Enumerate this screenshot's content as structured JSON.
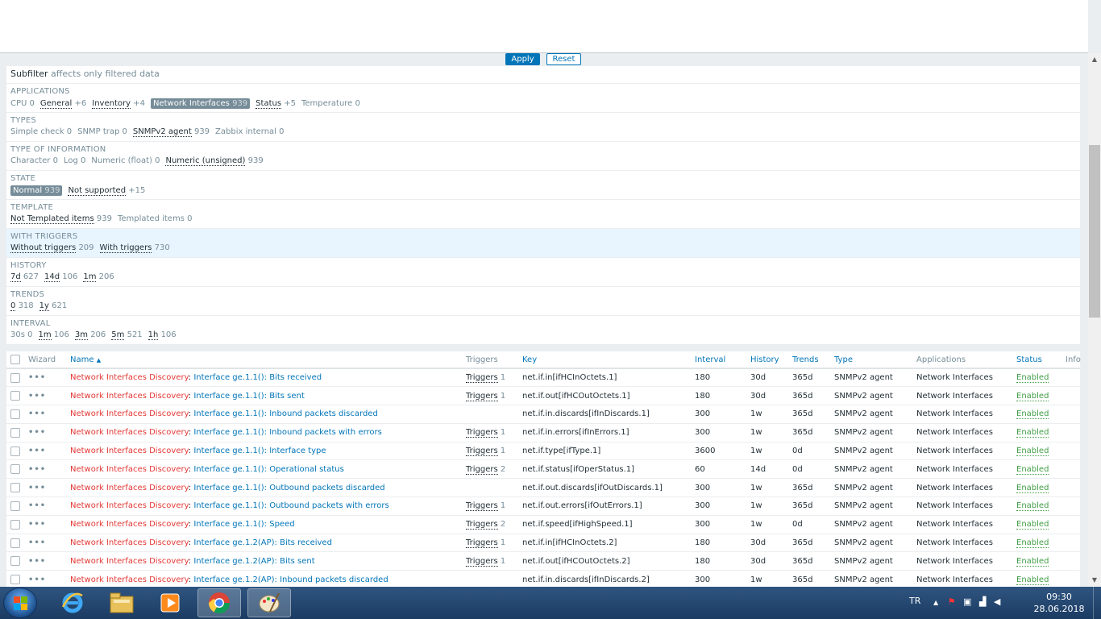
{
  "filter": {
    "apply_label": "Apply",
    "reset_label": "Reset"
  },
  "subfilter": {
    "title": "Subfilter",
    "note": "affects only filtered data",
    "groups": [
      {
        "heading": "APPLICATIONS",
        "items": [
          {
            "label": "CPU",
            "count": "0",
            "link": false,
            "selected": false
          },
          {
            "label": "General",
            "count": "+6",
            "link": true,
            "selected": false
          },
          {
            "label": "Inventory",
            "count": "+4",
            "link": true,
            "selected": false
          },
          {
            "label": "Network Interfaces",
            "count": "939",
            "link": true,
            "selected": true
          },
          {
            "label": "Status",
            "count": "+5",
            "link": true,
            "selected": false
          },
          {
            "label": "Temperature",
            "count": "0",
            "link": false,
            "selected": false
          }
        ]
      },
      {
        "heading": "TYPES",
        "items": [
          {
            "label": "Simple check",
            "count": "0",
            "link": false,
            "selected": false
          },
          {
            "label": "SNMP trap",
            "count": "0",
            "link": false,
            "selected": false
          },
          {
            "label": "SNMPv2 agent",
            "count": "939",
            "link": true,
            "selected": false
          },
          {
            "label": "Zabbix internal",
            "count": "0",
            "link": false,
            "selected": false
          }
        ]
      },
      {
        "heading": "TYPE OF INFORMATION",
        "items": [
          {
            "label": "Character",
            "count": "0",
            "link": false,
            "selected": false
          },
          {
            "label": "Log",
            "count": "0",
            "link": false,
            "selected": false
          },
          {
            "label": "Numeric (float)",
            "count": "0",
            "link": false,
            "selected": false
          },
          {
            "label": "Numeric (unsigned)",
            "count": "939",
            "link": true,
            "selected": false
          }
        ]
      },
      {
        "heading": "STATE",
        "items": [
          {
            "label": "Normal",
            "count": "939",
            "link": true,
            "selected": true
          },
          {
            "label": "Not supported",
            "count": "+15",
            "link": true,
            "selected": false
          }
        ]
      },
      {
        "heading": "TEMPLATE",
        "items": [
          {
            "label": "Not Templated items",
            "count": "939",
            "link": true,
            "selected": false
          },
          {
            "label": "Templated items",
            "count": "0",
            "link": false,
            "selected": false
          }
        ]
      },
      {
        "heading": "WITH TRIGGERS",
        "highlight": true,
        "items": [
          {
            "label": "Without triggers",
            "count": "209",
            "link": true,
            "selected": false
          },
          {
            "label": "With triggers",
            "count": "730",
            "link": true,
            "selected": false
          }
        ]
      },
      {
        "heading": "HISTORY",
        "items": [
          {
            "label": "7d",
            "count": "627",
            "link": true,
            "selected": false
          },
          {
            "label": "14d",
            "count": "106",
            "link": true,
            "selected": false
          },
          {
            "label": "1m",
            "count": "206",
            "link": true,
            "selected": false
          }
        ]
      },
      {
        "heading": "TRENDS",
        "items": [
          {
            "label": "0",
            "count": "318",
            "link": true,
            "selected": false
          },
          {
            "label": "1y",
            "count": "621",
            "link": true,
            "selected": false
          }
        ]
      },
      {
        "heading": "INTERVAL",
        "items": [
          {
            "label": "30s",
            "count": "0",
            "link": false,
            "selected": false
          },
          {
            "label": "1m",
            "count": "106",
            "link": true,
            "selected": false
          },
          {
            "label": "3m",
            "count": "206",
            "link": true,
            "selected": false
          },
          {
            "label": "5m",
            "count": "521",
            "link": true,
            "selected": false
          },
          {
            "label": "1h",
            "count": "106",
            "link": true,
            "selected": false
          }
        ]
      }
    ]
  },
  "table": {
    "columns": {
      "wizard": "Wizard",
      "name": "Name",
      "name_sort": "▲",
      "triggers": "Triggers",
      "key": "Key",
      "interval": "Interval",
      "history": "History",
      "trends": "Trends",
      "type": "Type",
      "applications": "Applications",
      "status": "Status",
      "info": "Info"
    },
    "rows": [
      {
        "parent": "Network Interfaces Discovery",
        "name": "Interface ge.1.1(): Bits received",
        "triggers": "Triggers",
        "trig_count": "1",
        "key": "net.if.in[ifHCInOctets.1]",
        "interval": "180",
        "history": "30d",
        "trends": "365d",
        "type": "SNMPv2 agent",
        "app": "Network Interfaces",
        "status": "Enabled"
      },
      {
        "parent": "Network Interfaces Discovery",
        "name": "Interface ge.1.1(): Bits sent",
        "triggers": "Triggers",
        "trig_count": "1",
        "key": "net.if.out[ifHCOutOctets.1]",
        "interval": "180",
        "history": "30d",
        "trends": "365d",
        "type": "SNMPv2 agent",
        "app": "Network Interfaces",
        "status": "Enabled"
      },
      {
        "parent": "Network Interfaces Discovery",
        "name": "Interface ge.1.1(): Inbound packets discarded",
        "triggers": "",
        "trig_count": "",
        "key": "net.if.in.discards[ifInDiscards.1]",
        "interval": "300",
        "history": "1w",
        "trends": "365d",
        "type": "SNMPv2 agent",
        "app": "Network Interfaces",
        "status": "Enabled"
      },
      {
        "parent": "Network Interfaces Discovery",
        "name": "Interface ge.1.1(): Inbound packets with errors",
        "triggers": "Triggers",
        "trig_count": "1",
        "key": "net.if.in.errors[ifInErrors.1]",
        "interval": "300",
        "history": "1w",
        "trends": "365d",
        "type": "SNMPv2 agent",
        "app": "Network Interfaces",
        "status": "Enabled"
      },
      {
        "parent": "Network Interfaces Discovery",
        "name": "Interface ge.1.1(): Interface type",
        "triggers": "Triggers",
        "trig_count": "1",
        "key": "net.if.type[ifType.1]",
        "interval": "3600",
        "history": "1w",
        "trends": "0d",
        "type": "SNMPv2 agent",
        "app": "Network Interfaces",
        "status": "Enabled"
      },
      {
        "parent": "Network Interfaces Discovery",
        "name": "Interface ge.1.1(): Operational status",
        "triggers": "Triggers",
        "trig_count": "2",
        "key": "net.if.status[ifOperStatus.1]",
        "interval": "60",
        "history": "14d",
        "trends": "0d",
        "type": "SNMPv2 agent",
        "app": "Network Interfaces",
        "status": "Enabled"
      },
      {
        "parent": "Network Interfaces Discovery",
        "name": "Interface ge.1.1(): Outbound packets discarded",
        "triggers": "",
        "trig_count": "",
        "key": "net.if.out.discards[ifOutDiscards.1]",
        "interval": "300",
        "history": "1w",
        "trends": "365d",
        "type": "SNMPv2 agent",
        "app": "Network Interfaces",
        "status": "Enabled"
      },
      {
        "parent": "Network Interfaces Discovery",
        "name": "Interface ge.1.1(): Outbound packets with errors",
        "triggers": "Triggers",
        "trig_count": "1",
        "key": "net.if.out.errors[ifOutErrors.1]",
        "interval": "300",
        "history": "1w",
        "trends": "365d",
        "type": "SNMPv2 agent",
        "app": "Network Interfaces",
        "status": "Enabled"
      },
      {
        "parent": "Network Interfaces Discovery",
        "name": "Interface ge.1.1(): Speed",
        "triggers": "Triggers",
        "trig_count": "2",
        "key": "net.if.speed[ifHighSpeed.1]",
        "interval": "300",
        "history": "1w",
        "trends": "0d",
        "type": "SNMPv2 agent",
        "app": "Network Interfaces",
        "status": "Enabled"
      },
      {
        "parent": "Network Interfaces Discovery",
        "name": "Interface ge.1.2(AP): Bits received",
        "triggers": "Triggers",
        "trig_count": "1",
        "key": "net.if.in[ifHCInOctets.2]",
        "interval": "180",
        "history": "30d",
        "trends": "365d",
        "type": "SNMPv2 agent",
        "app": "Network Interfaces",
        "status": "Enabled"
      },
      {
        "parent": "Network Interfaces Discovery",
        "name": "Interface ge.1.2(AP): Bits sent",
        "triggers": "Triggers",
        "trig_count": "1",
        "key": "net.if.out[ifHCOutOctets.2]",
        "interval": "180",
        "history": "30d",
        "trends": "365d",
        "type": "SNMPv2 agent",
        "app": "Network Interfaces",
        "status": "Enabled"
      },
      {
        "parent": "Network Interfaces Discovery",
        "name": "Interface ge.1.2(AP): Inbound packets discarded",
        "triggers": "",
        "trig_count": "",
        "key": "net.if.in.discards[ifInDiscards.2]",
        "interval": "300",
        "history": "1w",
        "trends": "365d",
        "type": "SNMPv2 agent",
        "app": "Network Interfaces",
        "status": "Enabled"
      }
    ]
  },
  "taskbar": {
    "apps": [
      {
        "name": "internet-explorer-icon"
      },
      {
        "name": "file-explorer-icon"
      },
      {
        "name": "media-player-icon"
      },
      {
        "name": "chrome-icon"
      },
      {
        "name": "paint-icon"
      }
    ],
    "lang": "TR",
    "time": "09:30",
    "date": "28.06.2018"
  },
  "colors": {
    "accent": "#0275b8",
    "parent_link": "#e33734",
    "enabled": "#429e47",
    "highlight_row": "#e8f5ff"
  }
}
